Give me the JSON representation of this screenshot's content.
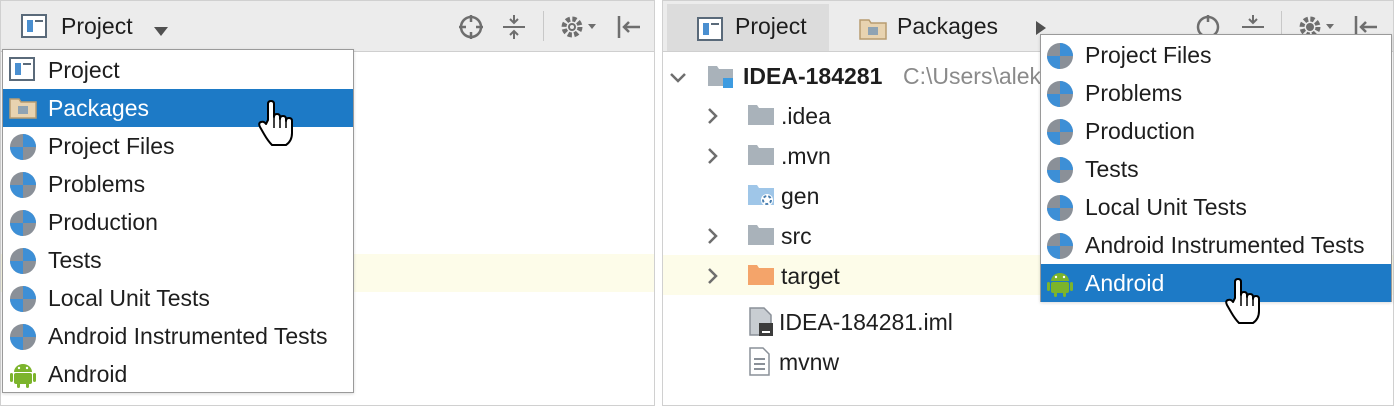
{
  "left": {
    "toolbar": {
      "view_label": "Project"
    },
    "menu": {
      "items": [
        {
          "label": "Project",
          "icon": "project-view-icon"
        },
        {
          "label": "Packages",
          "icon": "packages-icon"
        },
        {
          "label": "Project Files",
          "icon": "scope-pie-icon"
        },
        {
          "label": "Problems",
          "icon": "scope-pie-icon"
        },
        {
          "label": "Production",
          "icon": "scope-pie-icon"
        },
        {
          "label": "Tests",
          "icon": "scope-pie-icon"
        },
        {
          "label": "Local Unit Tests",
          "icon": "scope-pie-icon"
        },
        {
          "label": "Android Instrumented Tests",
          "icon": "scope-pie-icon"
        },
        {
          "label": "Android",
          "icon": "android-icon"
        }
      ],
      "selected_index": 1
    }
  },
  "right": {
    "toolbar": {
      "tab_project": "Project",
      "tab_packages": "Packages"
    },
    "tree": {
      "root_name": "IDEA-184281",
      "root_path": "C:\\Users\\alek",
      "items": [
        {
          "label": ".idea"
        },
        {
          "label": ".mvn"
        },
        {
          "label": "gen"
        },
        {
          "label": "src"
        },
        {
          "label": "target"
        },
        {
          "label": "IDEA-184281.iml"
        },
        {
          "label": "mvnw"
        }
      ]
    },
    "menu": {
      "items": [
        {
          "label": "Project Files",
          "icon": "scope-pie-icon"
        },
        {
          "label": "Problems",
          "icon": "scope-pie-icon"
        },
        {
          "label": "Production",
          "icon": "scope-pie-icon"
        },
        {
          "label": "Tests",
          "icon": "scope-pie-icon"
        },
        {
          "label": "Local Unit Tests",
          "icon": "scope-pie-icon"
        },
        {
          "label": "Android Instrumented Tests",
          "icon": "scope-pie-icon"
        },
        {
          "label": "Android",
          "icon": "android-icon"
        }
      ],
      "selected_index": 6
    }
  },
  "colors": {
    "selection": "#1d7ac6",
    "toolbar_bg": "#ececec",
    "folder": "#a9b2ba",
    "excluded_folder": "#f4a46a",
    "android_green": "#7cb42c"
  }
}
